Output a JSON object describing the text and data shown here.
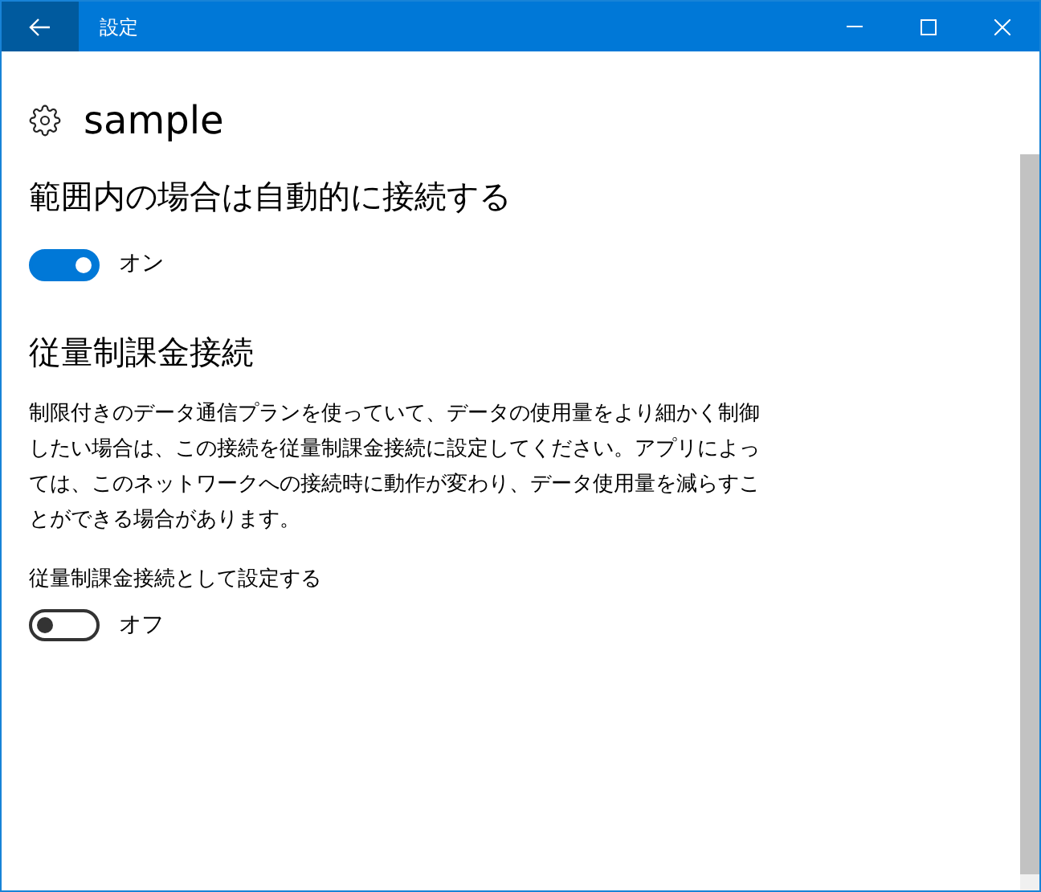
{
  "window": {
    "title": "設定"
  },
  "page": {
    "title": "sample"
  },
  "sections": [
    {
      "heading": "範囲内の場合は自動的に接続する",
      "toggle": {
        "on": true,
        "state_text": "オン"
      }
    },
    {
      "heading": "従量制課金接続",
      "description": "制限付きのデータ通信プランを使っていて、データの使用量をより細かく制御したい場合は、この接続を従量制課金接続に設定してください。アプリによっては、このネットワークへの接続時に動作が変わり、データ使用量を減らすことができる場合があります。",
      "toggle_label": "従量制課金接続として設定する",
      "toggle": {
        "on": false,
        "state_text": "オフ"
      }
    }
  ]
}
